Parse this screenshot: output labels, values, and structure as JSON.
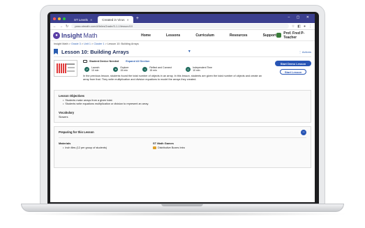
{
  "browser": {
    "tabs": [
      {
        "label": "ST Levels",
        "active": false
      },
      {
        "label": "Created in Virus",
        "active": true
      }
    ],
    "url": "pass.stmath.com/#/leIesGrade/3-1-1/lesson/10",
    "window_controls": "– ▢ ✕"
  },
  "app": {
    "logo_bold": "Insight",
    "logo_rest": "Math",
    "nav": [
      "Home",
      "Lessons",
      "Curriculum",
      "Resources",
      "Support"
    ],
    "user": "Prof. Fred P-Teacher"
  },
  "breadcrumb": {
    "root": "Insight Math",
    "grade": "Grade 3",
    "unit": "Unit 1",
    "cluster": "Cluster 1",
    "current": "Lesson 10: Building Arrays",
    "sep": " > "
  },
  "lesson": {
    "title": "Lesson 10: Building Arrays",
    "actions_label": "⋮ Actions"
  },
  "summary": {
    "device_label": "Student Device Needed",
    "expand_label": "Expand All Section",
    "stats": [
      {
        "title": "Launch",
        "value": "10 min",
        "icon": "rocket-icon"
      },
      {
        "title": "Explore",
        "value": "15 min",
        "icon": "compass-icon"
      },
      {
        "title": "Reflect and Connect",
        "value": "15 min",
        "icon": "share-icon"
      },
      {
        "title": "Independent Time",
        "value": "10 min",
        "icon": "person-icon"
      }
    ],
    "description": "In the previous lesson, students found the total number of objects in an array. In this lesson, students are given the total number of objects and create an array from that. They write multiplication and division equations to model the arrays they created.",
    "start_demo": "Start Demo Lesson",
    "start_lesson": "Start Lesson"
  },
  "objectives": {
    "heading": "Lesson Objectives",
    "items": [
      "Students make arrays from a given total.",
      "Students write equations multiplication or division to represent an array."
    ],
    "vocab_heading": "Vocabulary",
    "vocab": "Slowers"
  },
  "prep": {
    "heading": "Preparing for this Lesson",
    "materials_heading": "Materials",
    "materials": [
      "Inch tiles (12 per group of students)"
    ],
    "games_heading": "ST Math Games",
    "games": [
      "Distributive Boxes Intro"
    ]
  }
}
